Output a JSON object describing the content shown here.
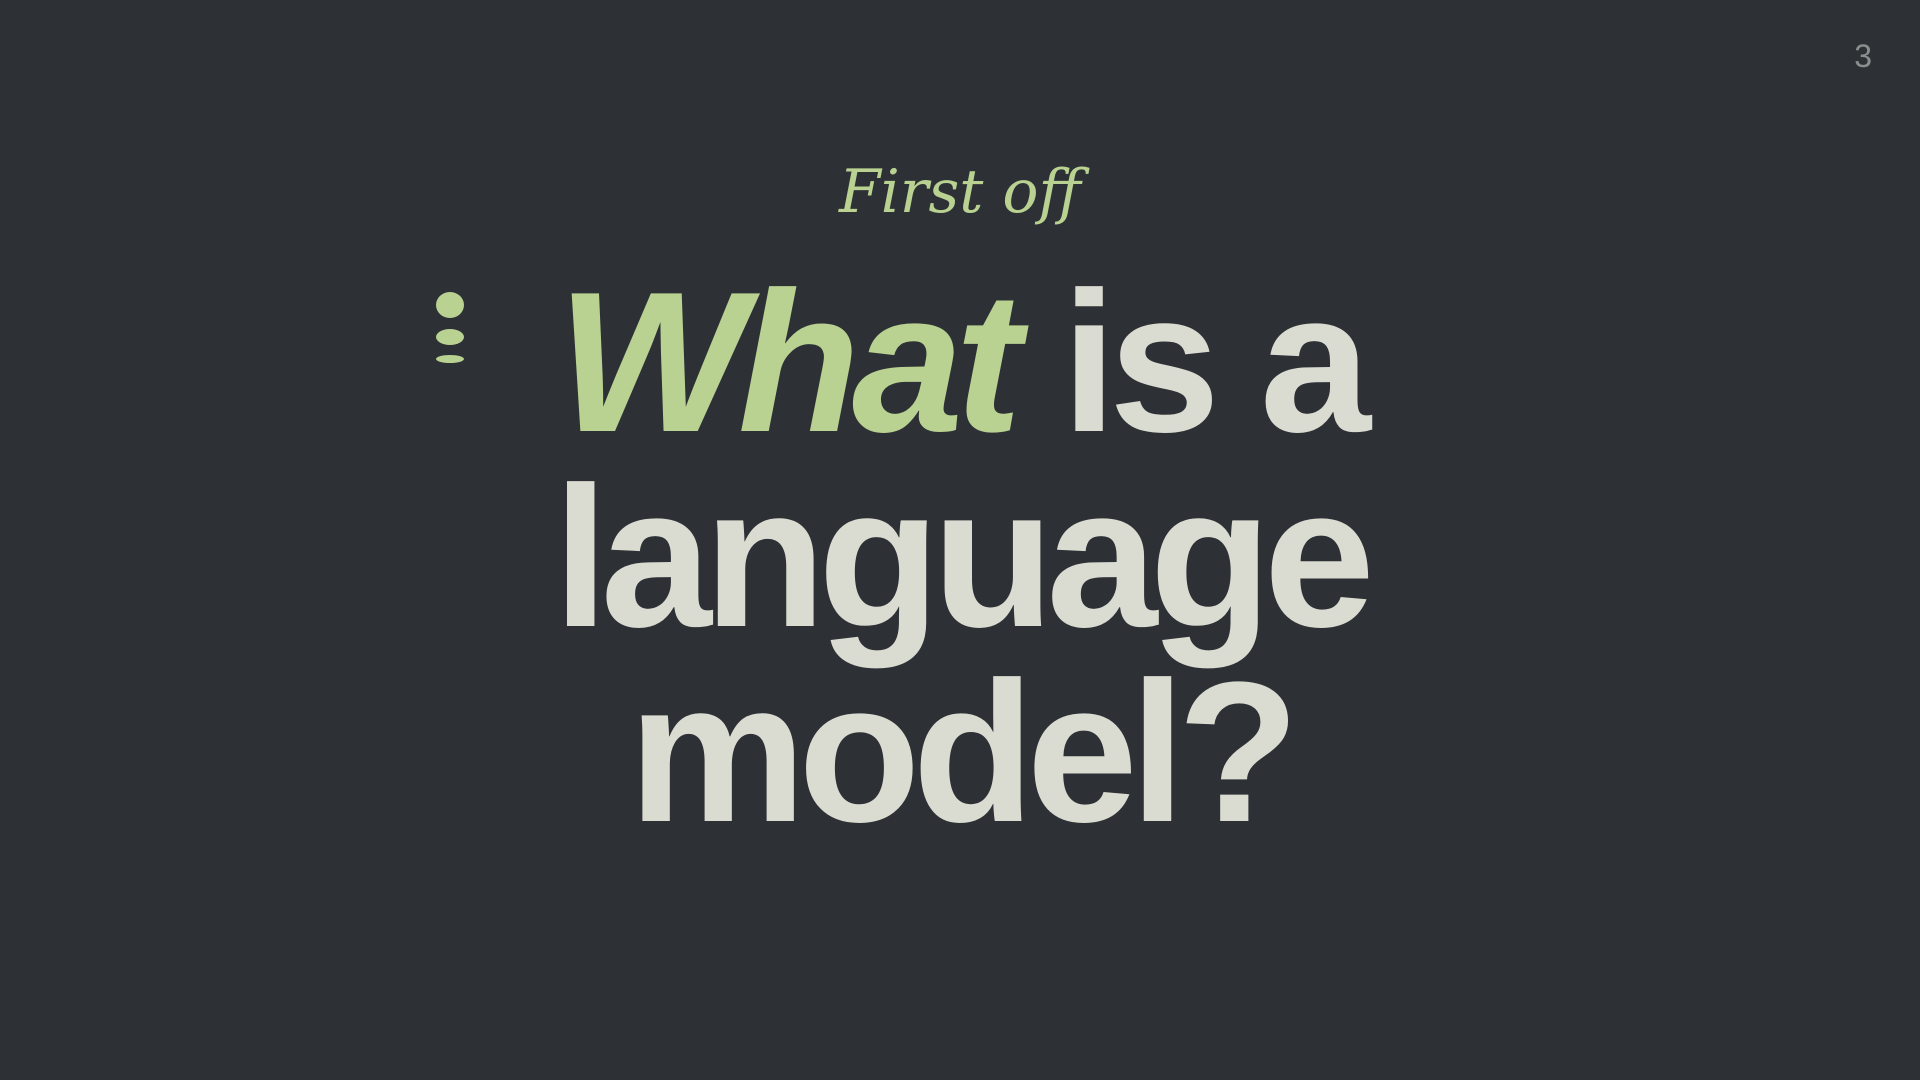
{
  "slide": {
    "page_number": "3",
    "eyebrow": "First off",
    "headline": {
      "accent_word": "What",
      "line1_rest": " is a",
      "line2": "language",
      "line3": "model?"
    }
  },
  "colors": {
    "background": "#2d3136",
    "accent": "#b9d191",
    "text": "#dadbd1",
    "page_number": "#8a8f8e"
  },
  "icons": {
    "bullet_mark": "stacked-dots-icon"
  }
}
